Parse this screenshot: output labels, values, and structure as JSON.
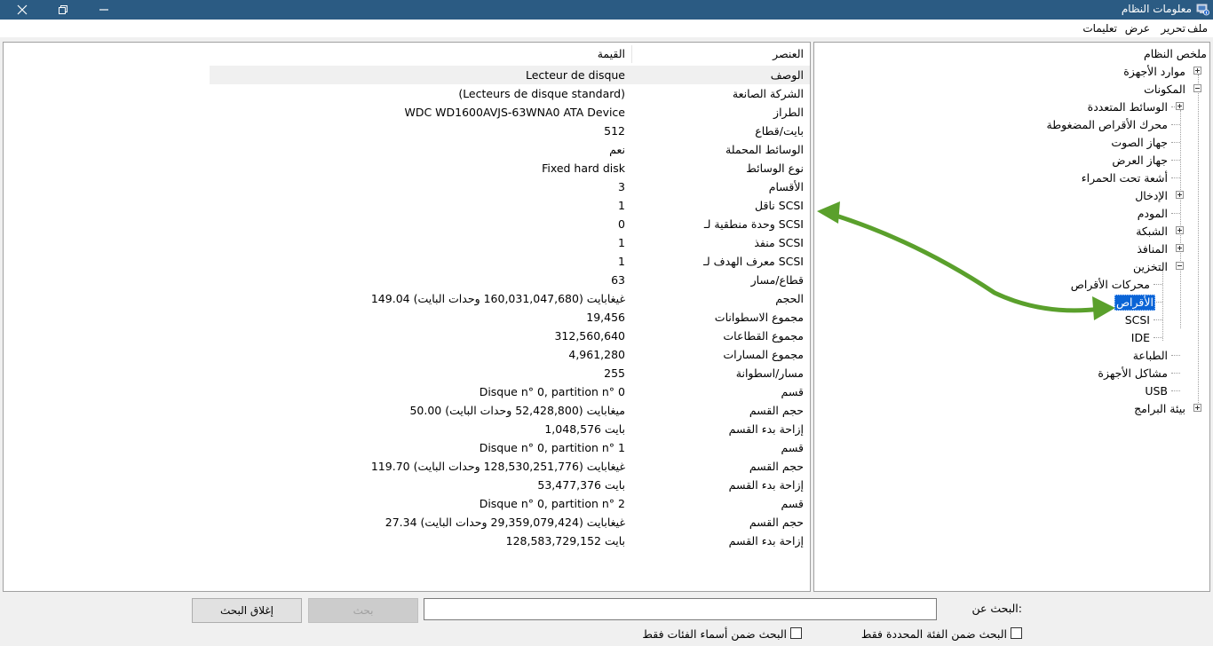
{
  "window": {
    "title": "معلومات النظام",
    "close": "✕",
    "restore": "⧉",
    "minimize": "—"
  },
  "menu": [
    "ملف",
    "تحرير",
    "عرض",
    "تعليمات"
  ],
  "tree": {
    "root": "ملخص النظام",
    "hardware_resources": "موارد الأجهزة",
    "components": "المكونات",
    "multimedia": "الوسائط المتعددة",
    "cd_rom": "محرك الأقراص المضغوطة",
    "sound": "جهاز الصوت",
    "display": "جهاز العرض",
    "infrared": "أشعة تحت الحمراء",
    "input": "الإدخال",
    "modem": "المودم",
    "network": "الشبكة",
    "ports": "المنافذ",
    "storage": "التخزين",
    "drives": "محركات الأقراص",
    "disks": "الأقراص",
    "scsi": "SCSI",
    "ide": "IDE",
    "printing": "الطباعة",
    "problem_devices": "مشاكل الأجهزة",
    "usb": "USB",
    "software_env": "بيئة البرامج"
  },
  "table": {
    "headers": {
      "item": "العنصر",
      "value": "القيمة"
    },
    "rows": [
      {
        "item": "الوصف",
        "value": "Lecteur de disque"
      },
      {
        "item": "الشركة الصانعة",
        "value": "(Lecteurs de disque standard)"
      },
      {
        "item": "الطراز",
        "value": "WDC WD1600AVJS-63WNA0 ATA Device"
      },
      {
        "item": "بايت/قطاع",
        "value": "512"
      },
      {
        "item": "الوسائط المحملة",
        "value": "نعم"
      },
      {
        "item": "نوع الوسائط",
        "value": "Fixed hard disk"
      },
      {
        "item": "الأقسام",
        "value": "3"
      },
      {
        "item": "ناقل SCSI",
        "value": "1"
      },
      {
        "item": "وحدة منطقية لـ SCSI",
        "value": "0"
      },
      {
        "item": "منفذ SCSI",
        "value": "1"
      },
      {
        "item": "معرف الهدف لـ SCSI",
        "value": "1"
      },
      {
        "item": "قطاع/مسار",
        "value": "63"
      },
      {
        "item": "الحجم",
        "value": "149.04 غيغابايت (160,031,047,680 وحدات البايت)"
      },
      {
        "item": "مجموع الاسطوانات",
        "value": "19,456"
      },
      {
        "item": "مجموع القطاعات",
        "value": "312,560,640"
      },
      {
        "item": "مجموع المسارات",
        "value": "4,961,280"
      },
      {
        "item": "مسار/اسطوانة",
        "value": "255"
      },
      {
        "item": "قسم",
        "value": "Disque n° 0, partition n° 0"
      },
      {
        "item": "حجم القسم",
        "value": "50.00 ميغابايت (52,428,800 وحدات البايت)"
      },
      {
        "item": "إزاحة بدء القسم",
        "value": "1,048,576 بايت"
      },
      {
        "item": "قسم",
        "value": "Disque n° 0, partition n° 1"
      },
      {
        "item": "حجم القسم",
        "value": "119.70 غيغابايت (128,530,251,776 وحدات البايت)"
      },
      {
        "item": "إزاحة بدء القسم",
        "value": "53,477,376 بايت"
      },
      {
        "item": "قسم",
        "value": "Disque n° 0, partition n° 2"
      },
      {
        "item": "حجم القسم",
        "value": "27.34 غيغابايت (29,359,079,424 وحدات البايت)"
      },
      {
        "item": "إزاحة بدء القسم",
        "value": "128,583,729,152 بايت"
      }
    ]
  },
  "search": {
    "label": "البحث عن:",
    "value": "",
    "find_button": "بحث",
    "close_button": "إغلاق البحث",
    "option_selected_category": "البحث ضمن الفئة المحددة فقط",
    "option_category_names": "البحث ضمن أسماء الفئات فقط"
  },
  "colors": {
    "titlebar": "#2b5b83",
    "selection": "#0a64d6",
    "arrow": "#5aa02c"
  }
}
